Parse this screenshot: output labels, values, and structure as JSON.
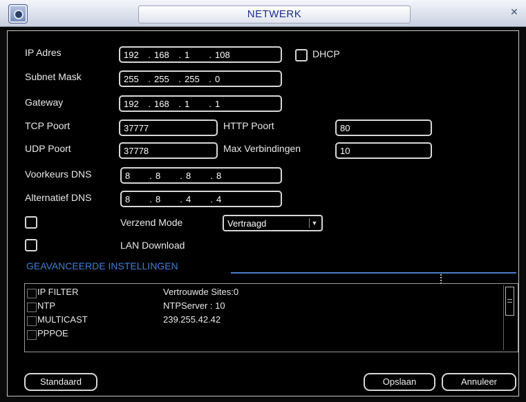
{
  "window": {
    "title": "NETWERK"
  },
  "network": {
    "ip_label": "IP Adres",
    "ip": [
      "192",
      "168",
      "1",
      "108"
    ],
    "dhcp_label": "DHCP",
    "subnet_label": "Subnet Mask",
    "subnet": [
      "255",
      "255",
      "255",
      "0"
    ],
    "gateway_label": "Gateway",
    "gateway": [
      "192",
      "168",
      "1",
      "1"
    ],
    "tcp_label": "TCP Poort",
    "tcp_value": "37777",
    "http_label": "HTTP Poort",
    "http_value": "80",
    "udp_label": "UDP Poort",
    "udp_value": "37778",
    "max_label": "Max Verbindingen",
    "max_value": "10",
    "dns1_label": "Voorkeurs DNS",
    "dns1": [
      "8",
      "8",
      "8",
      "8"
    ],
    "dns2_label": "Alternatief DNS",
    "dns2": [
      "8",
      "8",
      "4",
      "4"
    ],
    "send_mode_label": "Verzend Mode",
    "send_mode_value": "Vertraagd",
    "lan_download_label": "LAN Download"
  },
  "advanced": {
    "title": "GEAVANCEERDE INSTELLINGEN",
    "rows": [
      {
        "name": "IP FILTER",
        "info": "Vertrouwde Sites:0"
      },
      {
        "name": "NTP",
        "info": "NTPServer : 10"
      },
      {
        "name": "MULTICAST",
        "info": "239.255.42.42"
      },
      {
        "name": "PPPOE",
        "info": ""
      }
    ]
  },
  "buttons": {
    "default": "Standaard",
    "save": "Opslaan",
    "cancel": "Annuleer"
  }
}
